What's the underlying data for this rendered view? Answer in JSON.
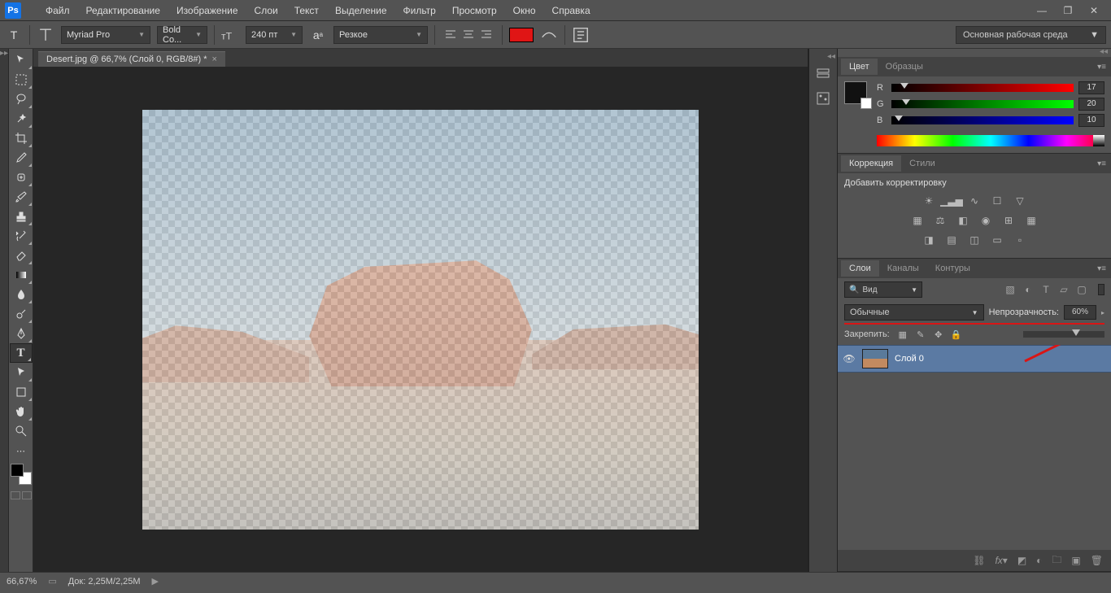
{
  "menu": {
    "items": [
      "Файл",
      "Редактирование",
      "Изображение",
      "Слои",
      "Текст",
      "Выделение",
      "Фильтр",
      "Просмотр",
      "Окно",
      "Справка"
    ]
  },
  "optbar": {
    "font": "Myriad Pro",
    "weight": "Bold Co...",
    "size": "240 пт",
    "aa": "Резкое",
    "workspace": "Основная рабочая среда"
  },
  "doc": {
    "tab": "Desert.jpg @ 66,7% (Слой 0, RGB/8#) *"
  },
  "status": {
    "zoom": "66,67%",
    "doc": "Док: 2,25M/2,25M"
  },
  "color": {
    "tab_color": "Цвет",
    "tab_swatches": "Образцы",
    "r_label": "R",
    "g_label": "G",
    "b_label": "B",
    "r": "17",
    "g": "20",
    "b": "10"
  },
  "corr": {
    "tab_corr": "Коррекция",
    "tab_styles": "Стили",
    "title": "Добавить корректировку"
  },
  "layers": {
    "tab_layers": "Слои",
    "tab_channels": "Каналы",
    "tab_paths": "Контуры",
    "search": "Вид",
    "blend": "Обычные",
    "opacity_label": "Непрозрачность:",
    "opacity": "60%",
    "lock_label": "Закрепить:",
    "item0": "Слой 0"
  }
}
